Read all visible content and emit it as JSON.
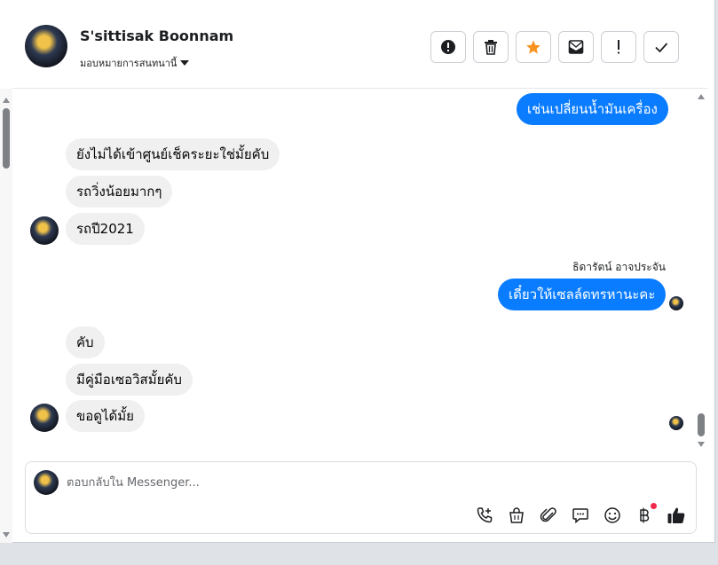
{
  "contact": {
    "name": "S'sittisak Boonnam",
    "assign_label": "มอบหมายการสนทนานี้"
  },
  "actions": [
    {
      "name": "report-spam-button",
      "icon": "alert-circle-icon"
    },
    {
      "name": "delete-button",
      "icon": "trash-icon"
    },
    {
      "name": "star-button",
      "icon": "star-icon"
    },
    {
      "name": "mark-unread-button",
      "icon": "envelope-icon"
    },
    {
      "name": "follow-up-button",
      "icon": "exclamation-icon"
    },
    {
      "name": "mark-done-button",
      "icon": "checkmark-icon"
    }
  ],
  "colors": {
    "accent": "#0a7cff",
    "star": "#f7931e",
    "incoming_bubble": "#f0f0f0",
    "notification_dot": "#f02849"
  },
  "messages": [
    {
      "direction": "out",
      "text": "เช่นเปลี่ยนน้ำมันเครื่อง"
    },
    {
      "direction": "in",
      "text": "ยังไม่ได้เข้าศูนย์เช็คระยะใช่มั้ยคับ"
    },
    {
      "direction": "in",
      "text": "รถวิ่งน้อยมากๆ"
    },
    {
      "direction": "in",
      "text": "รถปี2021"
    },
    {
      "direction": "out",
      "sender": "ธิดารัตน์ อาจประจัน",
      "text": "เดี๋ยวให้เซลล์ดทรหานะคะ"
    },
    {
      "direction": "in",
      "text": "คับ"
    },
    {
      "direction": "in",
      "text": "มีคู่มือเซอวิสมั้ยคับ"
    },
    {
      "direction": "in",
      "text": "ขอดูได้มั้ย"
    }
  ],
  "composer": {
    "placeholder": "ตอบกลับใน Messenger...",
    "tools": [
      "call-add-icon",
      "shopping-bag-icon",
      "paperclip-icon",
      "chat-bubble-icon",
      "smiley-icon",
      "baht-icon",
      "thumbs-up-icon"
    ]
  }
}
